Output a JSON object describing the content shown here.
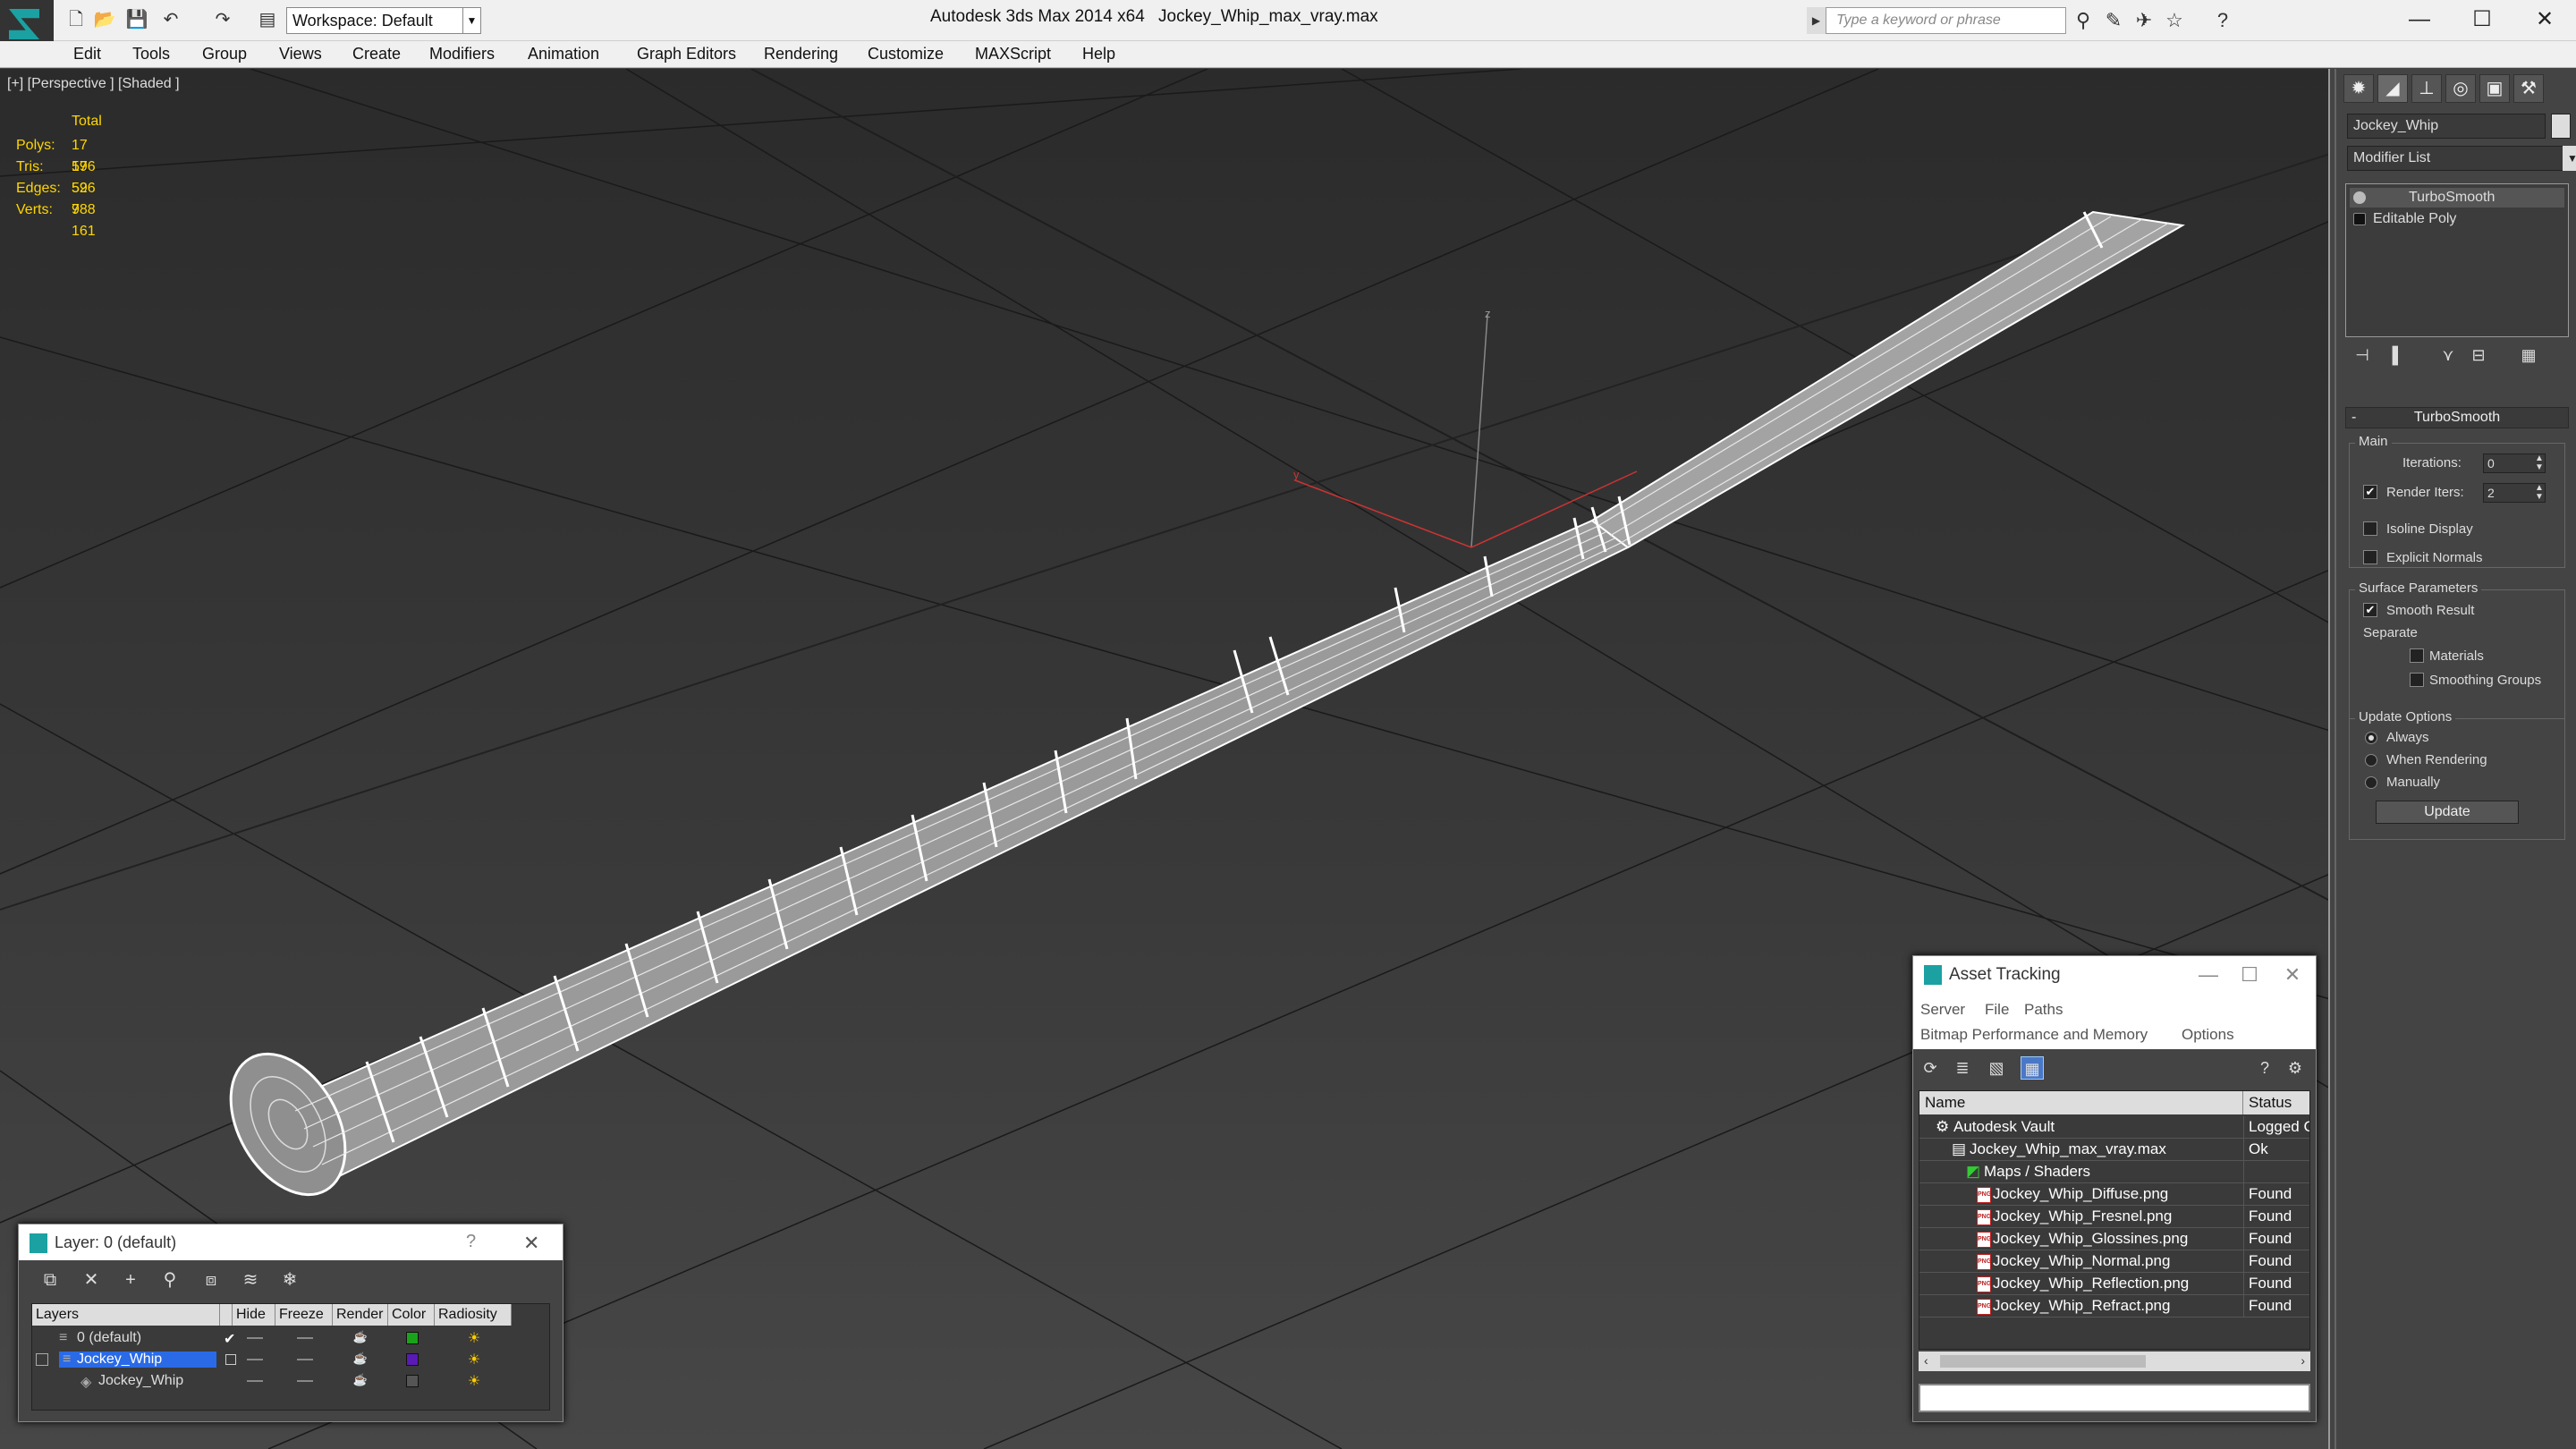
{
  "window": {
    "app_title": "Autodesk 3ds Max  2014 x64",
    "file_title": "Jockey_Whip_max_vray.max",
    "workspace": "Workspace: Default",
    "search_placeholder": "Type a keyword or phrase",
    "minimize": "—",
    "maximize": "☐",
    "close": "✕"
  },
  "menubar": [
    "Edit",
    "Tools",
    "Group",
    "Views",
    "Create",
    "Modifiers",
    "Animation",
    "Graph Editors",
    "Rendering",
    "Customize",
    "MAXScript",
    "Help"
  ],
  "viewport": {
    "label": "[+] [Perspective ] [Shaded ]",
    "stats_header": "Total",
    "stats": [
      {
        "k": "Polys:",
        "v": "17 596"
      },
      {
        "k": "Tris:",
        "v": "17 596"
      },
      {
        "k": "Edges:",
        "v": "52 788"
      },
      {
        "k": "Verts:",
        "v": "9 161"
      }
    ],
    "gizmo_y": "y",
    "gizmo_z": "z"
  },
  "command_panel": {
    "object_name": "Jockey_Whip",
    "modifier_list": "Modifier List",
    "stack": [
      "TurboSmooth",
      "Editable Poly"
    ],
    "rollout_title": "TurboSmooth",
    "rollout_toggle": "-",
    "main_group": "Main",
    "iterations_label": "Iterations:",
    "iterations_value": "0",
    "render_iters_label": "Render Iters:",
    "render_iters_value": "2",
    "render_iters_checked": "✔",
    "isoline_label": "Isoline Display",
    "explicit_normals_label": "Explicit Normals",
    "surface_group": "Surface Parameters",
    "smooth_result_label": "Smooth Result",
    "smooth_result_checked": "✔",
    "separate_label": "Separate",
    "materials_label": "Materials",
    "smoothing_groups_label": "Smoothing Groups",
    "update_group": "Update Options",
    "always_label": "Always",
    "when_rendering_label": "When Rendering",
    "manually_label": "Manually",
    "update_button": "Update"
  },
  "asset_tracking": {
    "title": "Asset Tracking",
    "menu": [
      "Server",
      "File",
      "Paths",
      "Bitmap Performance and Memory",
      "Options"
    ],
    "columns": [
      "Name",
      "Status"
    ],
    "rows": [
      {
        "name": "Autodesk Vault",
        "status": "Logged C"
      },
      {
        "name": "Jockey_Whip_max_vray.max",
        "status": "Ok"
      },
      {
        "name": "Maps / Shaders",
        "status": ""
      },
      {
        "name": "Jockey_Whip_Diffuse.png",
        "status": "Found"
      },
      {
        "name": "Jockey_Whip_Fresnel.png",
        "status": "Found"
      },
      {
        "name": "Jockey_Whip_Glossines.png",
        "status": "Found"
      },
      {
        "name": "Jockey_Whip_Normal.png",
        "status": "Found"
      },
      {
        "name": "Jockey_Whip_Reflection.png",
        "status": "Found"
      },
      {
        "name": "Jockey_Whip_Refract.png",
        "status": "Found"
      }
    ],
    "png_tag": "PNG"
  },
  "layers": {
    "title": "Layer: 0 (default)",
    "help": "?",
    "close": "✕",
    "columns": [
      "Layers",
      "Hide",
      "Freeze",
      "Render",
      "Color",
      "Radiosity"
    ],
    "rows": [
      {
        "name": "0 (default)",
        "check": "✔",
        "color": "#1aa31a"
      },
      {
        "name": "Jockey_Whip",
        "check": "",
        "color": "#5a1ab4"
      },
      {
        "name": "Jockey_Whip",
        "check": "",
        "color": "#555555"
      }
    ]
  }
}
